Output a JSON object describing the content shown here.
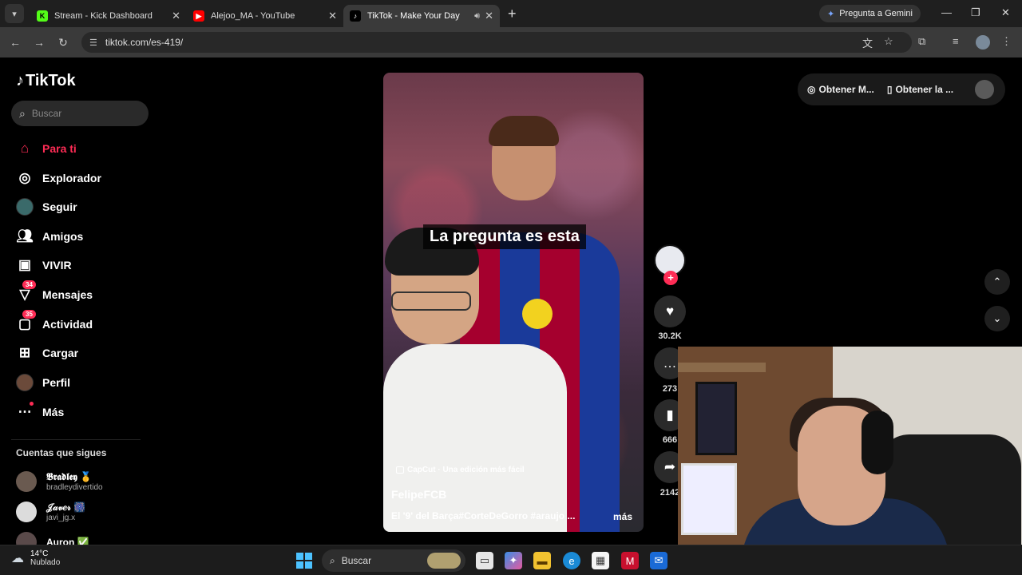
{
  "browser": {
    "tabs": [
      {
        "title": "Stream - Kick Dashboard",
        "favicon": "K",
        "favicon_color": "#53fc18"
      },
      {
        "title": "Alejoo_MA - YouTube",
        "favicon": "▶",
        "favicon_color": "#ff0000"
      },
      {
        "title": "TikTok - Make Your Day",
        "favicon": "♪",
        "favicon_color": "#ffffff"
      }
    ],
    "gemini_label": "Pregunta a Gemini",
    "url": "tiktok.com/es-419/"
  },
  "tiktok": {
    "logo_text": "TikTok",
    "search_placeholder": "Buscar",
    "nav": [
      {
        "label": "Para ti",
        "icon": "home-icon"
      },
      {
        "label": "Explorador",
        "icon": "compass-icon"
      },
      {
        "label": "Seguir",
        "icon": "avatar-icon"
      },
      {
        "label": "Amigos",
        "icon": "friends-icon"
      },
      {
        "label": "VIVIR",
        "icon": "live-icon"
      },
      {
        "label": "Mensajes",
        "icon": "messages-icon",
        "badge": "34"
      },
      {
        "label": "Actividad",
        "icon": "activity-icon",
        "badge": "35"
      },
      {
        "label": "Cargar",
        "icon": "upload-icon"
      },
      {
        "label": "Perfil",
        "icon": "profile-icon"
      },
      {
        "label": "Más",
        "icon": "more-icon"
      }
    ],
    "following_title": "Cuentas que sigues",
    "accounts": [
      {
        "name": "𝕭𝖗𝖆𝖉𝖑𝖊𝖞 🥇",
        "handle": "bradleydivertido"
      },
      {
        "name": "𝒥𝒶𝓋𝑒𝓇 🎆",
        "handle": "javi_jg.x"
      },
      {
        "name": "Auron ✅",
        "handle": ""
      }
    ],
    "top_right": {
      "get_app_1": "Obtener M...",
      "get_app_2": "Obtener la ..."
    },
    "video": {
      "caption_overlay": "La pregunta es esta",
      "capcut": "CapCut · Una edición más fácil",
      "author": "FelipeFCB",
      "description": "El '9' del Barça#CorteDeGorro #araujo ...",
      "more": "más",
      "likes": "30.2K",
      "comments": "273",
      "saves": "666",
      "shares": "2142"
    }
  },
  "taskbar": {
    "temp": "14°C",
    "weather": "Nublado",
    "search": "Buscar"
  }
}
